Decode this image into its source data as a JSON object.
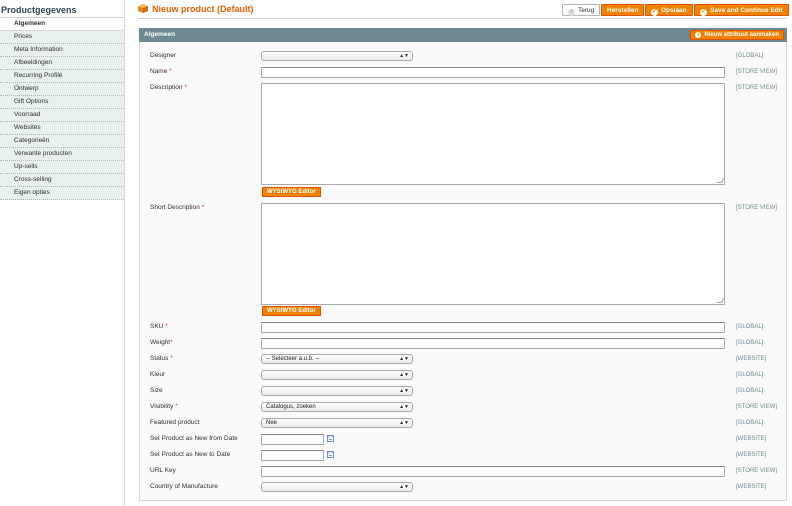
{
  "sidebar": {
    "title": "Productgegevens",
    "tabs": [
      {
        "label": "Algemeen",
        "active": true
      },
      {
        "label": "Prices"
      },
      {
        "label": "Meta Information"
      },
      {
        "label": "Afbeeldingen"
      },
      {
        "label": "Recurring Profile"
      },
      {
        "label": "Ontwerp"
      },
      {
        "label": "Gift Options"
      },
      {
        "label": "Voorraad"
      },
      {
        "label": "Websites"
      },
      {
        "label": "Categorieën"
      },
      {
        "label": "Verwante producten"
      },
      {
        "label": "Up-sells"
      },
      {
        "label": "Cross-selling"
      },
      {
        "label": "Eigen opties"
      }
    ]
  },
  "header": {
    "title": "Nieuw product (Default)",
    "back_label": "Terug",
    "reset_label": "Herstellen",
    "save_label": "Opslaan",
    "save_continue_label": "Save and Continue Edit"
  },
  "panel": {
    "title": "Algemeen",
    "new_attribute_label": "Nieuw attribuut aanmaken"
  },
  "form": {
    "designer": {
      "label": "Designer",
      "value": "",
      "scope": "[GLOBAL]"
    },
    "name": {
      "label": "Name",
      "required": "*",
      "value": "",
      "scope": "[STORE VIEW]"
    },
    "description": {
      "label": "Description",
      "required": "*",
      "value": "",
      "scope": "[STORE VIEW]",
      "editor_label": "WYSIWYG Editor"
    },
    "short_description": {
      "label": "Short Description",
      "required": "*",
      "value": "",
      "scope": "[STORE VIEW]",
      "editor_label": "WYSIWYG Editor"
    },
    "sku": {
      "label": "SKU",
      "required": "*",
      "value": "",
      "scope": "[GLOBAL]"
    },
    "weight": {
      "label": "Weight",
      "required": "*",
      "value": "",
      "scope": "[GLOBAL]"
    },
    "status": {
      "label": "Status",
      "required": "*",
      "value": "-- Selecteer a.u.b. --",
      "scope": "[WEBSITE]"
    },
    "kleur": {
      "label": "Kleur",
      "value": "",
      "scope": "[GLOBAL]"
    },
    "size": {
      "label": "Size",
      "value": "",
      "scope": "[GLOBAL]"
    },
    "visibility": {
      "label": "Visibility",
      "required": "*",
      "value": "Catalogus, zoeken",
      "scope": "[STORE VIEW]"
    },
    "featured": {
      "label": "Featured product",
      "value": "Nee",
      "scope": "[GLOBAL]"
    },
    "new_from": {
      "label": "Set Product as New from Date",
      "value": "",
      "scope": "[WEBSITE]"
    },
    "new_to": {
      "label": "Set Product as New to Date",
      "value": "",
      "scope": "[WEBSITE]"
    },
    "url_key": {
      "label": "URL Key",
      "value": "",
      "scope": "[STORE VIEW]"
    },
    "country": {
      "label": "Country of Manufacture",
      "value": "",
      "scope": "[WEBSITE]"
    }
  },
  "colors": {
    "accent": "#f18200",
    "title": "#eb5e00",
    "panel_header": "#6f8992",
    "tab_bg": "#e7efef"
  },
  "icons": {
    "header": "product-box-icon",
    "calendar": "calendar-icon",
    "select_arrow": "up-down-arrows-icon"
  }
}
